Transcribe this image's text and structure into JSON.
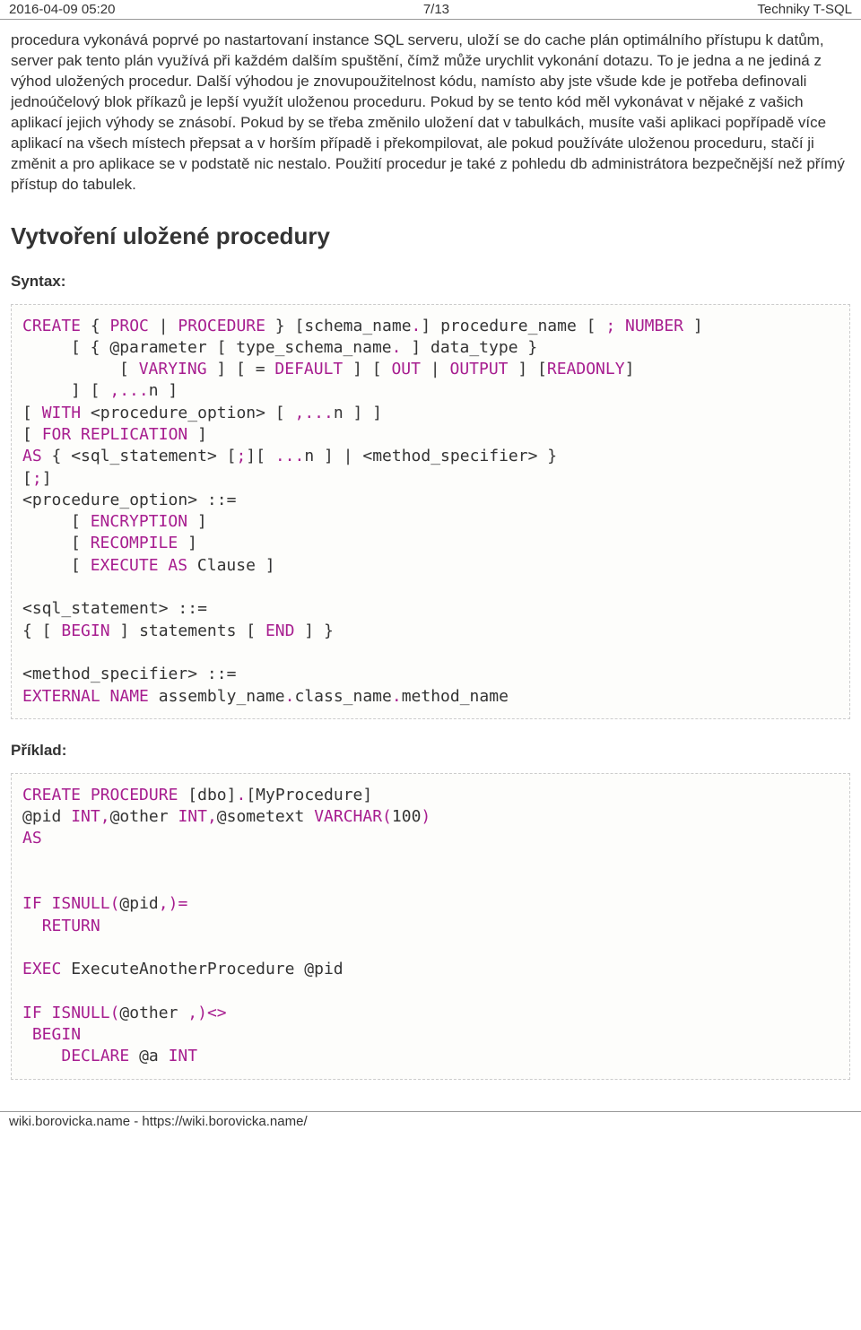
{
  "header": {
    "left": "2016-04-09 05:20",
    "center": "7/13",
    "right": "Techniky T-SQL"
  },
  "body": {
    "paragraph": "procedura vykonává poprvé po nastartovaní instance SQL serveru, uloží se do cache plán optimálního přístupu k datům, server pak tento plán využívá při každém dalším spuštění, čímž může urychlit vykonání dotazu. To je jedna a ne jediná z výhod uložených procedur. Další výhodou je znovupoužitelnost kódu, namísto aby jste všude kde je potřeba definovali jednoúčelový blok příkazů je lepší využít uloženou proceduru. Pokud by se tento kód měl vykonávat v nějaké z vašich aplikací jejich výhody se znásobí. Pokud by se třeba změnilo uložení dat v tabulkách, musíte vaši aplikaci popřípadě více aplikací na všech místech přepsat a v horším případě i překompilovat, ale pokud používáte uloženou proceduru, stačí ji změnit a pro aplikace se v podstatě nic nestalo. Použití procedur je také z pohledu db administrátora bezpečnější než přímý přístup do tabulek.",
    "heading": "Vytvoření uložené procedury",
    "syntax_label": "Syntax:",
    "example_label": "Příklad:"
  },
  "syntax": {
    "t": {
      "create": "CREATE",
      "proc": "PROC",
      "procedure": "PROCEDURE",
      "schema_name": "schema_name",
      "procedure_name": "procedure_name",
      "number": "NUMBER",
      "parameter": "@parameter",
      "type_schema_name": "type_schema_name",
      "data_type": "data_type",
      "varying": "VARYING",
      "default": "DEFAULT",
      "out": "OUT",
      "output": "OUTPUT",
      "readonly": "READONLY",
      "n": "n",
      "with": "WITH",
      "procedure_option": "procedure_option",
      "for": "FOR",
      "replication": "REPLICATION",
      "as": "AS",
      "sql_statement": "sql_statement",
      "method_specifier": "method_specifier",
      "encryption": "ENCRYPTION",
      "recompile": "RECOMPILE",
      "execute": "EXECUTE",
      "clause": "Clause",
      "begin": "BEGIN",
      "statements": "statements",
      "end": "END",
      "external": "EXTERNAL",
      "name": "NAME",
      "assembly_name": "assembly_name",
      "class_name": "class_name",
      "method_name": "method_name"
    }
  },
  "example": {
    "t": {
      "create": "CREATE",
      "procedure": "PROCEDURE",
      "dbo": "dbo",
      "myprocedure": "MyProcedure",
      "pid": "@pid",
      "int": "INT",
      "other": "@other",
      "sometext": "@sometext",
      "varchar": "VARCHAR",
      "hundred": "100",
      "as": "AS",
      "if": "IF",
      "isnull": "ISNULL",
      "return": "RETURN",
      "exec": "EXEC",
      "execanother": "ExecuteAnotherProcedure",
      "begin": "BEGIN",
      "declare": "DECLARE",
      "a": "@a"
    }
  },
  "footer": {
    "text": "wiki.borovicka.name - https://wiki.borovicka.name/"
  }
}
